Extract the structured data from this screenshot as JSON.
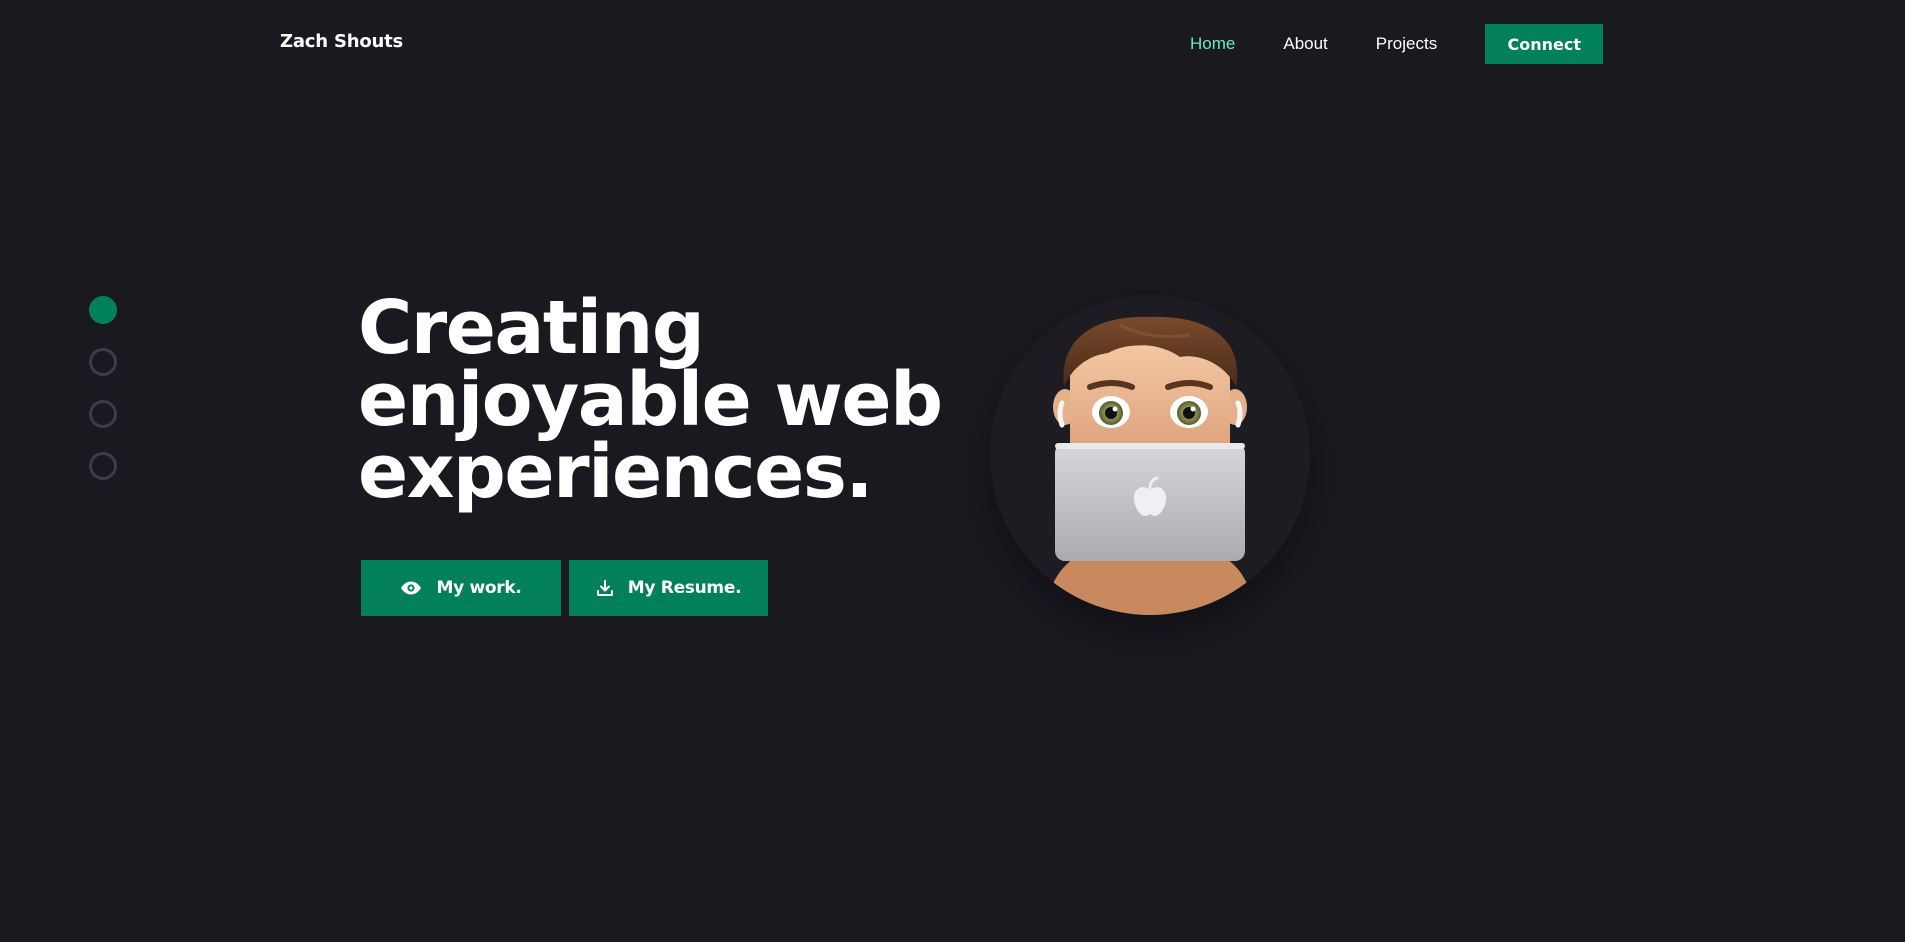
{
  "header": {
    "brand": "Zach Shouts",
    "nav": [
      {
        "label": "Home",
        "active": true
      },
      {
        "label": "About",
        "active": false
      },
      {
        "label": "Projects",
        "active": false
      }
    ],
    "connect_label": "Connect"
  },
  "section_dots": {
    "count": 4,
    "active_index": 0
  },
  "hero": {
    "headline_lines": [
      "Creating",
      "enjoyable web",
      "experiences."
    ],
    "buttons": {
      "work": {
        "label": "My work.",
        "icon": "eye-icon"
      },
      "resume": {
        "label": "My Resume.",
        "icon": "download-icon"
      }
    },
    "avatar": "memoji-avatar-with-laptop"
  },
  "colors": {
    "background": "#1a1920",
    "accent": "#02805a",
    "active_link": "#6ee7b7",
    "dot_inactive": "#3e3d47"
  }
}
